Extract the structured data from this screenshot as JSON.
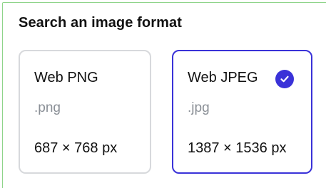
{
  "heading": "Search an image format",
  "formats": [
    {
      "name": "Web PNG",
      "extension": ".png",
      "dimensions": "687 × 768 px",
      "selected": false
    },
    {
      "name": "Web JPEG",
      "extension": ".jpg",
      "dimensions": "1387 × 1536 px",
      "selected": true
    }
  ],
  "colors": {
    "accent": "#3a32d8",
    "card_border": "#d7d9dc",
    "muted_text": "#8a8f96",
    "panel_border": "#8fd48a"
  },
  "icons": {
    "selected_indicator": "check-circle-icon"
  }
}
